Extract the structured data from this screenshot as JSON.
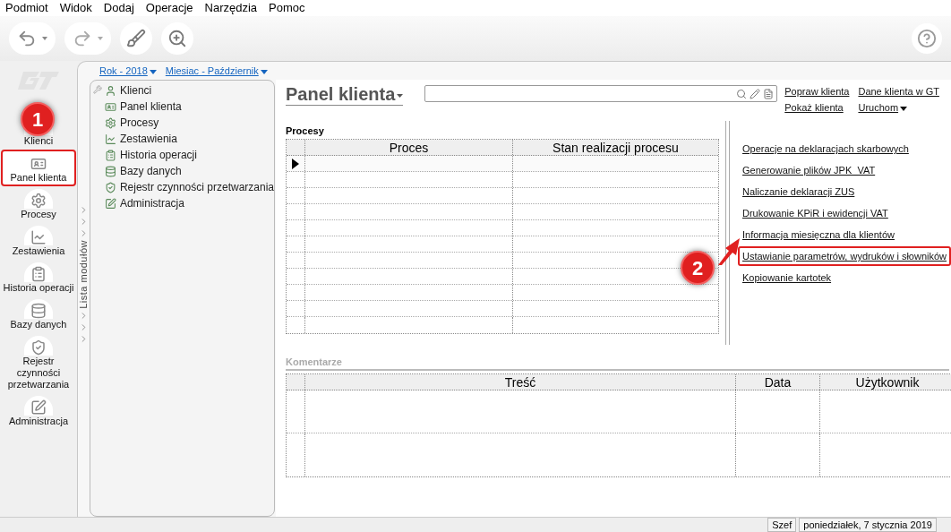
{
  "menu": [
    "Podmiot",
    "Widok",
    "Dodaj",
    "Operacje",
    "Narzędzia",
    "Pomoc"
  ],
  "nav": [
    {
      "label": "Klienci",
      "highlighted": false
    },
    {
      "label": "Panel klienta",
      "highlighted": true
    },
    {
      "label": "Procesy",
      "highlighted": false
    },
    {
      "label": "Zestawienia",
      "highlighted": false
    },
    {
      "label": "Historia operacji",
      "highlighted": false
    },
    {
      "label": "Bazy danych",
      "highlighted": false
    },
    {
      "label": "Rejestr czynności przetwarzania",
      "highlighted": false
    },
    {
      "label": "Administracja",
      "highlighted": false
    }
  ],
  "period": [
    "Rok - 2018",
    "Miesiac - Październik"
  ],
  "side_strip": "Lista modułów",
  "modules": [
    "Klienci",
    "Panel klienta",
    "Procesy",
    "Zestawienia",
    "Historia operacji",
    "Bazy danych",
    "Rejestr czynności przetwarzania",
    "Administracja"
  ],
  "panel_title": "Panel klienta",
  "header_links": [
    "Popraw klienta",
    "Dane klienta w GT",
    "Pokaż klienta",
    "Uruchom"
  ],
  "procesy": {
    "title": "Procesy",
    "columns": [
      "Proces",
      "Stan realizacji procesu"
    ],
    "rows": [
      {
        "selected": true
      },
      {
        "selected": false
      },
      {
        "selected": false
      },
      {
        "selected": false
      },
      {
        "selected": false
      },
      {
        "selected": false
      },
      {
        "selected": false
      },
      {
        "selected": false
      },
      {
        "selected": false
      },
      {
        "selected": false
      },
      {
        "selected": false
      }
    ]
  },
  "actions": [
    {
      "label": "Operacje na deklaracjach skarbowych",
      "highlighted": false
    },
    {
      "label": "Generowanie plików JPK_VAT",
      "highlighted": false
    },
    {
      "label": "Naliczanie deklaracji ZUS",
      "highlighted": false
    },
    {
      "label": "Drukowanie KPiR i ewidencji VAT",
      "highlighted": false
    },
    {
      "label": "Informacja miesięczna dla klientów",
      "highlighted": false
    },
    {
      "label": "Ustawianie parametrów, wydruków i słowników",
      "highlighted": true
    },
    {
      "label": "Kopiowanie kartotek",
      "highlighted": false
    }
  ],
  "komentarze": {
    "title": "Komentarze",
    "columns": [
      "Treść",
      "Data",
      "Użytkownik"
    ],
    "rows": [
      {
        "selected": false
      },
      {
        "selected": false
      }
    ]
  },
  "annotations": [
    "1",
    "2"
  ],
  "status_bar": [
    "Szef",
    "poniedziałek, 7 stycznia 2019"
  ]
}
